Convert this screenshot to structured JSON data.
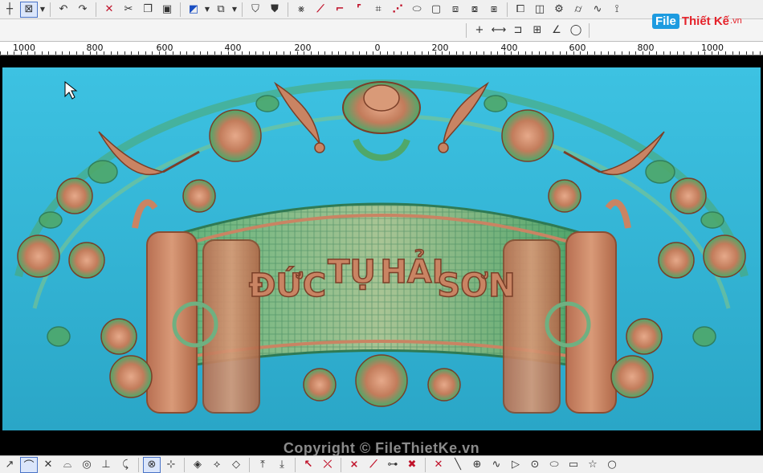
{
  "toolbar_top": {
    "icons": [
      "crosshair-icon",
      "window-select-icon",
      "undo-icon",
      "redo-icon",
      "delete-icon",
      "cut-icon",
      "copy-icon",
      "paste-icon",
      "view-color-icon",
      "view-box-icon",
      "shade-icon",
      "shield-icon",
      "trim-icon",
      "line-icon",
      "corner-icon",
      "fillet-icon",
      "offset-icon",
      "node-icon",
      "ellipse-icon",
      "frame-icon",
      "layer-icon",
      "group-icon",
      "align-icon",
      "mirror-icon",
      "rotate-icon",
      "scale-icon",
      "fold-icon",
      "wave-icon",
      "tree-icon"
    ]
  },
  "toolbar_sub": {
    "icons": [
      "add-point-icon",
      "dimension-icon",
      "snap-corner-icon",
      "measure-box-icon",
      "angle-icon",
      "lasso-icon"
    ]
  },
  "brand": {
    "file": "File",
    "name": "Thiết Kế",
    "vn": ".vn"
  },
  "ruler": {
    "labels": [
      "1000",
      "800",
      "600",
      "400",
      "200",
      "0",
      "200",
      "400",
      "600",
      "800",
      "1000"
    ]
  },
  "watermark": {
    "copyright": "Copyright © FileThietKe.vn"
  },
  "artwork": {
    "description_text_visible": "ĐỨC TỤ HẢI SƠN",
    "characters": [
      "ĐỨC",
      "TỤ",
      "HẢI",
      "SƠN"
    ],
    "colors": {
      "background": "#2fb9d8",
      "copper": "#c98463",
      "green": "#4fa86a",
      "teal": "#4fb3a8"
    }
  },
  "toolbar_bottom": {
    "icons": [
      "arrow-diag-icon",
      "arc-tool-icon",
      "cross-tool-icon",
      "curve-tool-icon",
      "target-tool-icon",
      "perpendicular-icon",
      "trim-curve-icon",
      "node-add-icon",
      "node-edit-icon",
      "diamond-node-icon",
      "diamond-x-icon",
      "diamond-plus-icon",
      "layer-up-icon",
      "layer-down-icon",
      "arrow-up-icon",
      "arrow-split-icon",
      "join-icon",
      "break-icon",
      "delete-node-icon",
      "star-tool-icon",
      "line-tool-icon",
      "circle-point-icon",
      "wave-tool-icon",
      "triangle-tool-icon",
      "target-circle-icon",
      "ellipse-tool-icon",
      "rectangle-tool-icon",
      "star-shape-icon",
      "circle-tool-icon"
    ]
  }
}
